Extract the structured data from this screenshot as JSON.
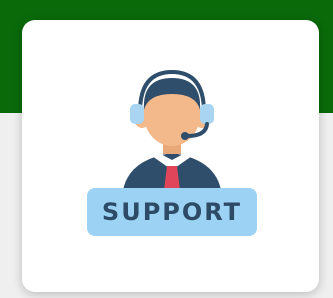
{
  "support_card": {
    "label": "SUPPORT",
    "icon": "customer-support-agent-icon"
  },
  "colors": {
    "header_band": "#0a6a0a",
    "card_background": "#ffffff",
    "label_plate": "#9cd3f4",
    "label_text": "#2d4b66",
    "hair": "#2e4e6c",
    "skin": "#f4b98a",
    "headset": "#a9d4f2",
    "tie": "#e0455a",
    "suit": "#2e4e6c"
  }
}
